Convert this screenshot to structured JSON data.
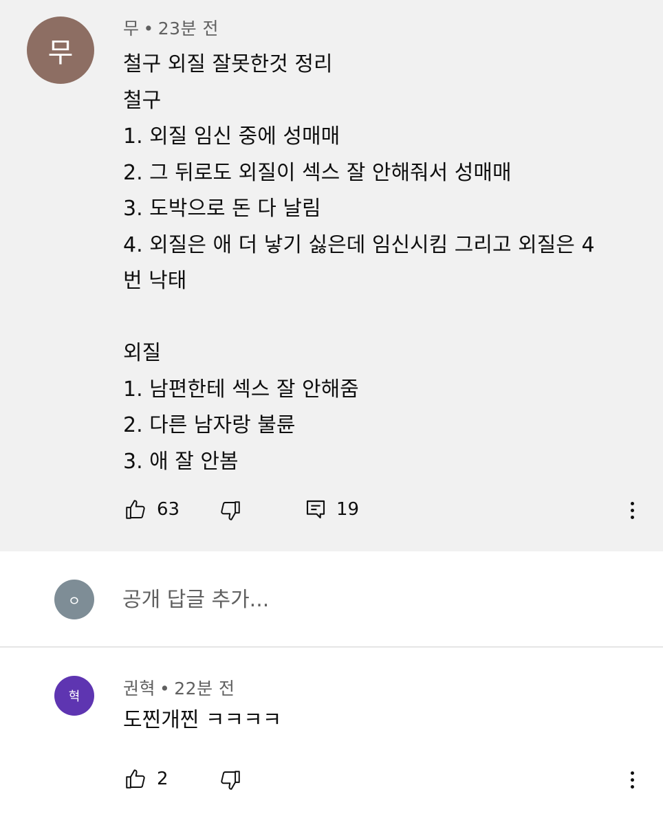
{
  "main_comment": {
    "avatar_letter": "무",
    "avatar_color": "#8d6e63",
    "author": "무",
    "time": "23분 전",
    "lines": [
      "철구 외질 잘못한것 정리",
      "철구",
      "1. 외질 임신 중에 성매매",
      "2. 그 뒤로도 외질이 섹스 잘 안해줘서 성매매",
      "3. 도박으로 돈 다 날림",
      "4. 외질은 애 더 낳기 싫은데 임신시킴 그리고 외질은 4",
      "번 낙태",
      "",
      "외질",
      "1. 남편한테 섹스 잘 안해줌",
      "2. 다른 남자랑 불륜",
      "3. 애 잘 안봄"
    ],
    "like_count": "63",
    "reply_count": "19"
  },
  "reply_box": {
    "avatar_letter": "ㅇ",
    "avatar_color": "#7e8d96",
    "placeholder": "공개 답글 추가..."
  },
  "reply": {
    "avatar_letter": "혁",
    "avatar_color": "#5e35b1",
    "author": "권혁",
    "time": "22분 전",
    "text": "도찐개찐 ㅋㅋㅋㅋ",
    "like_count": "2"
  },
  "icons": {
    "like": "thumbs-up-icon",
    "dislike": "thumbs-down-icon",
    "replies": "comment-icon",
    "more": "more-vert-icon"
  },
  "separator": "•"
}
